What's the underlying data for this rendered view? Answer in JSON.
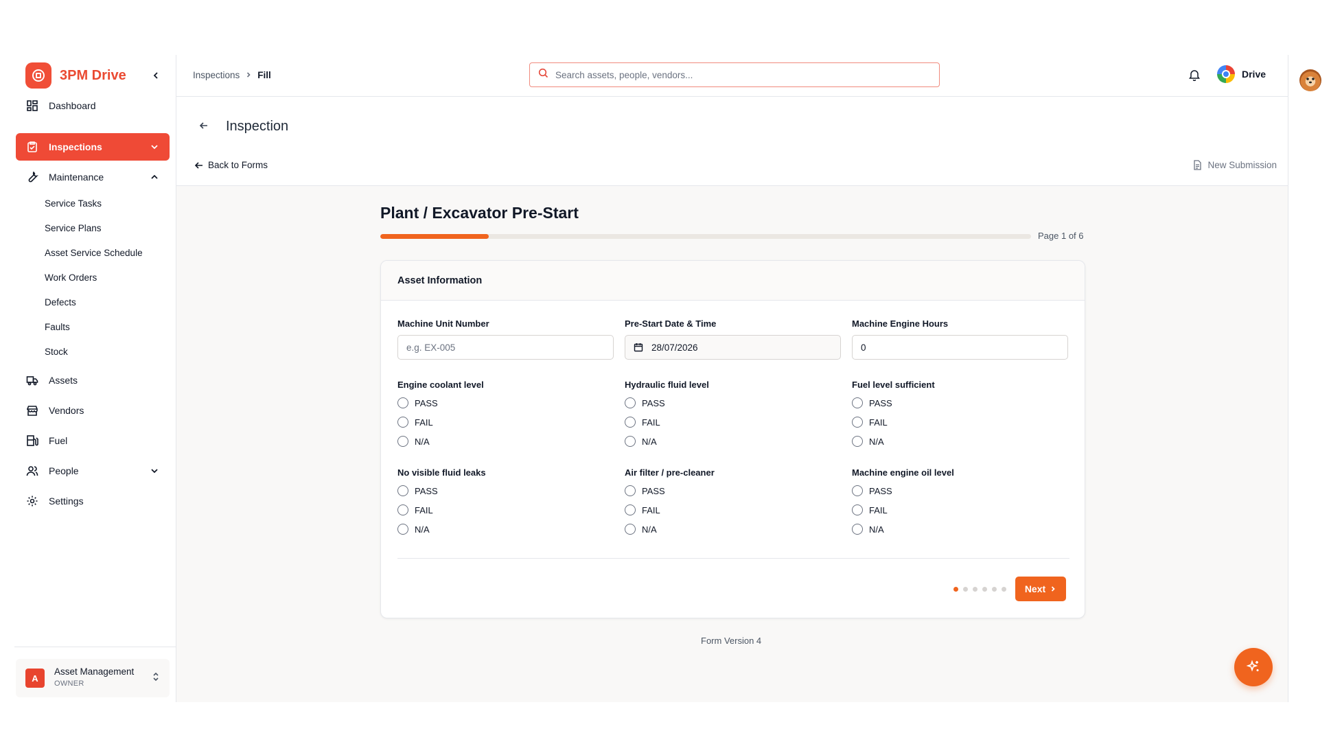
{
  "brand": {
    "name": "3PM Drive"
  },
  "sidebar": {
    "items": [
      {
        "label": "Dashboard",
        "icon": "dashboard-icon"
      },
      {
        "label": "Inspections",
        "icon": "clipboard-check-icon",
        "active": true
      },
      {
        "label": "Maintenance",
        "icon": "wrench-icon",
        "expanded": true
      },
      {
        "label": "Assets",
        "icon": "truck-icon"
      },
      {
        "label": "Vendors",
        "icon": "store-icon"
      },
      {
        "label": "Fuel",
        "icon": "fuel-icon"
      },
      {
        "label": "People",
        "icon": "users-icon"
      },
      {
        "label": "Settings",
        "icon": "gear-icon"
      }
    ],
    "maintenance_sub": [
      "Service Tasks",
      "Service Plans",
      "Asset Service Schedule",
      "Work Orders",
      "Defects",
      "Faults",
      "Stock"
    ],
    "org": {
      "avatar_letter": "A",
      "name": "Asset Management",
      "role": "OWNER"
    }
  },
  "topbar": {
    "breadcrumb": [
      "Inspections",
      "Fill"
    ],
    "search_placeholder": "Search assets, people, vendors...",
    "user_name": "Drive"
  },
  "page": {
    "title": "Inspection",
    "back_label": "Back to Forms",
    "new_submission_label": "New Submission"
  },
  "form": {
    "title": "Plant / Excavator Pre-Start",
    "page_label": "Page 1 of 6",
    "progress_fraction": 0.1667,
    "section_title": "Asset Information",
    "fields": {
      "unit_number": {
        "label": "Machine Unit Number",
        "placeholder": "e.g. EX-005"
      },
      "datetime": {
        "label": "Pre-Start Date & Time",
        "value": "28/07/2026"
      },
      "engine_hours": {
        "label": "Machine Engine Hours",
        "value": "0"
      }
    },
    "checks": [
      {
        "label": "Engine coolant level"
      },
      {
        "label": "Hydraulic fluid level"
      },
      {
        "label": "Fuel level sufficient"
      },
      {
        "label": "No visible fluid leaks"
      },
      {
        "label": "Air filter / pre-cleaner"
      },
      {
        "label": "Machine engine oil level"
      }
    ],
    "options": [
      "PASS",
      "FAIL",
      "N/A"
    ],
    "current_page": 1,
    "total_pages": 6,
    "next_label": "Next",
    "version_label": "Form Version 4"
  },
  "colors": {
    "accent": "#f0641e",
    "brand": "#ef4a36"
  }
}
